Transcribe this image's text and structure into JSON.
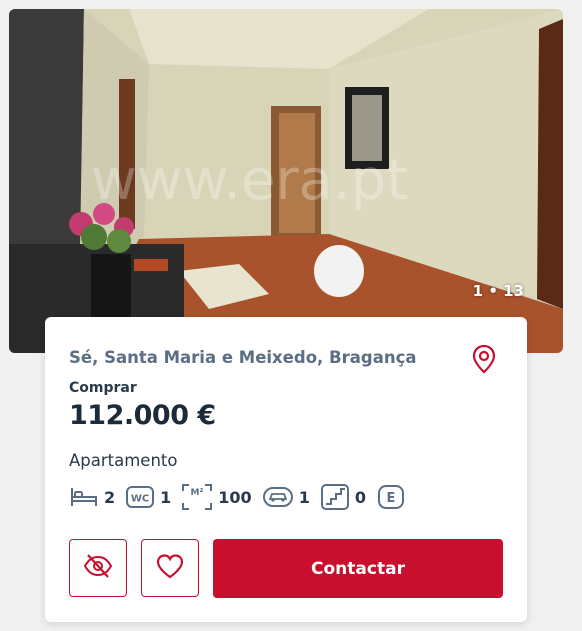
{
  "listing": {
    "photo": {
      "watermark": "www.era.pt",
      "counter": "1 • 13"
    },
    "location": "Sé, Santa Maria e Meixedo, Bragança",
    "operation": "Comprar",
    "price": "112.000 €",
    "property_type": "Apartamento",
    "features": {
      "bedrooms": "2",
      "bathrooms": "1",
      "area_m2": "100",
      "parking": "1",
      "floor": "0",
      "energy_label": "E"
    },
    "actions": {
      "contact_label": "Contactar"
    }
  },
  "colors": {
    "accent": "#c8102e",
    "text_primary": "#1c2a3a",
    "location_text": "#5b6e84",
    "icon_stroke": "#5b6e84"
  },
  "icons": [
    "bed-icon",
    "wc-icon",
    "m2-area-icon",
    "car-icon",
    "stairs-icon",
    "energy-label-icon",
    "map-pin-icon",
    "eye-off-icon",
    "heart-icon"
  ]
}
